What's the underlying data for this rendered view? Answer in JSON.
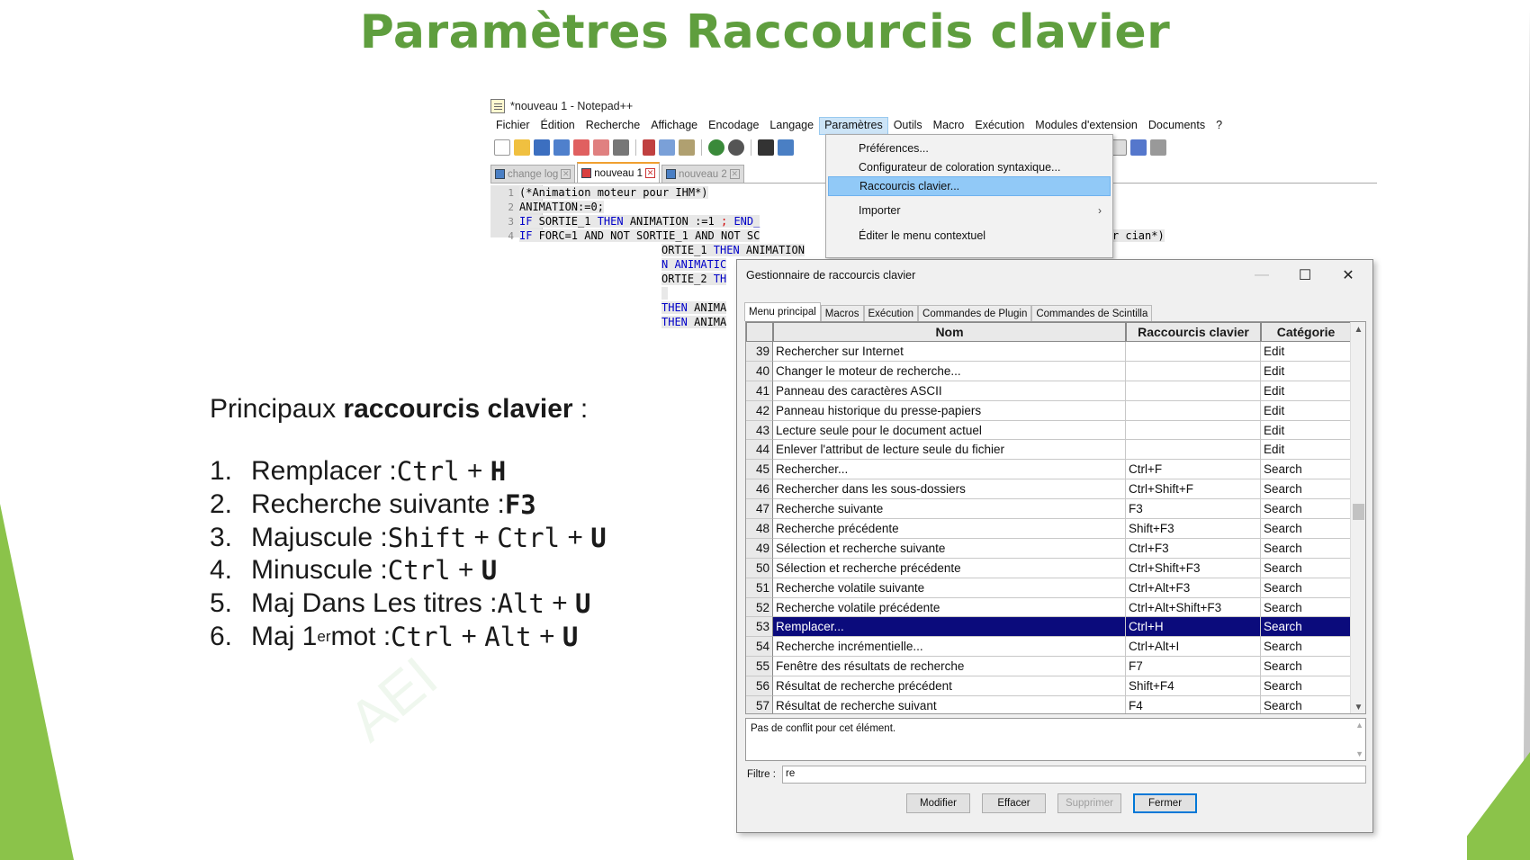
{
  "slide": {
    "title": "Paramètres Raccourcis clavier",
    "lead_text": "Principaux ",
    "lead_bold": "raccourcis clavier",
    "lead_end": " :",
    "watermark": "AEI",
    "shortcuts": [
      {
        "num": "1.",
        "label": "Remplacer : ",
        "parts": [
          {
            "t": "Ctrl",
            "s": "mono"
          },
          {
            "t": " + ",
            "s": "plain"
          },
          {
            "t": "H",
            "s": "kb"
          }
        ]
      },
      {
        "num": "2.",
        "label": "Recherche suivante : ",
        "parts": [
          {
            "t": "F3",
            "s": "kb"
          }
        ]
      },
      {
        "num": "3.",
        "label": "Majuscule : ",
        "parts": [
          {
            "t": "Shift",
            "s": "mono"
          },
          {
            "t": " + ",
            "s": "plain"
          },
          {
            "t": "Ctrl",
            "s": "mono"
          },
          {
            "t": " + ",
            "s": "plain"
          },
          {
            "t": "U",
            "s": "kb"
          }
        ]
      },
      {
        "num": "4.",
        "label": "Minuscule : ",
        "parts": [
          {
            "t": "Ctrl",
            "s": "mono"
          },
          {
            "t": " + ",
            "s": "plain"
          },
          {
            "t": "U",
            "s": "kb"
          }
        ]
      },
      {
        "num": "5.",
        "label": "Maj Dans Les titres : ",
        "parts": [
          {
            "t": "Alt",
            "s": "mono"
          },
          {
            "t": " + ",
            "s": "plain"
          },
          {
            "t": "U",
            "s": "kb"
          }
        ]
      },
      {
        "num": "6.",
        "label": "Maj 1",
        "sup": "er",
        "label2": " mot : ",
        "parts": [
          {
            "t": "Ctrl",
            "s": "mono"
          },
          {
            "t": " + ",
            "s": "plain"
          },
          {
            "t": "Alt",
            "s": "mono"
          },
          {
            "t": " + ",
            "s": "plain"
          },
          {
            "t": "U",
            "s": "kb"
          }
        ]
      }
    ]
  },
  "npp": {
    "window_title": "*nouveau 1 - Notepad++",
    "menu": [
      "Fichier",
      "Édition",
      "Recherche",
      "Affichage",
      "Encodage",
      "Langage",
      "Paramètres",
      "Outils",
      "Macro",
      "Exécution",
      "Modules d'extension",
      "Documents",
      "?"
    ],
    "active_menu": "Paramètres",
    "tabs": [
      "change log",
      "nouveau 1",
      "nouveau 2"
    ],
    "active_tab": "nouveau 1",
    "code": {
      "l1": "1",
      "l2": "2",
      "l3": "3",
      "l4": "4",
      "c1": "(*Animation moteur pour IHM*)",
      "c2": "ANIMATION:=0;",
      "c3_if": "IF",
      "c3_a": " SORTIE_1 ",
      "c3_then": "THEN",
      "c3_b": " ANIMATION :=1 ",
      "c3_semi": ";",
      "c3_end": " END_",
      "c4_if": "IF",
      "c4_a": " FORC=1 AND NOT SORTIE_1 AND NOT SC",
      "c4_tail": "uleur cian*)",
      "c5_a": "ORTIE_1 ",
      "c5_then": "THEN",
      "c5_b": " ANIMATION",
      "c6_a": "N ANIMATIC",
      "c7_a": "ORTIE_2 ",
      "c7_then": "TH",
      "c8_then": "THEN",
      "c8_b": " ANIMA",
      "c9_then": "THEN",
      "c9_b": " ANIMA"
    },
    "dropdown": {
      "items": [
        "Préférences...",
        "Configurateur de coloration syntaxique...",
        "Raccourcis clavier...",
        "Importer",
        "Éditer le menu contextuel"
      ],
      "highlighted": "Raccourcis clavier...",
      "submenu_arrow": "›"
    }
  },
  "dialog": {
    "title": "Gestionnaire de raccourcis clavier",
    "controls": {
      "minimize": "—",
      "maximize": "☐",
      "close": "✕"
    },
    "tabs": [
      "Menu principal",
      "Macros",
      "Exécution",
      "Commandes de Plugin",
      "Commandes de Scintilla"
    ],
    "active_tab": "Menu principal",
    "columns": {
      "name": "Nom",
      "shortcut": "Raccourcis clavier",
      "category": "Catégorie"
    },
    "rows": [
      {
        "n": "39",
        "name": "Rechercher sur Internet",
        "shortcut": "",
        "category": "Edit"
      },
      {
        "n": "40",
        "name": "Changer le moteur de recherche...",
        "shortcut": "",
        "category": "Edit"
      },
      {
        "n": "41",
        "name": "Panneau des caractères ASCII",
        "shortcut": "",
        "category": "Edit"
      },
      {
        "n": "42",
        "name": "Panneau historique du presse-papiers",
        "shortcut": "",
        "category": "Edit"
      },
      {
        "n": "43",
        "name": "Lecture seule pour le document actuel",
        "shortcut": "",
        "category": "Edit"
      },
      {
        "n": "44",
        "name": "Enlever l'attribut de lecture seule du fichier",
        "shortcut": "",
        "category": "Edit"
      },
      {
        "n": "45",
        "name": "Rechercher...",
        "shortcut": "Ctrl+F",
        "category": "Search"
      },
      {
        "n": "46",
        "name": "Rechercher dans les sous-dossiers",
        "shortcut": "Ctrl+Shift+F",
        "category": "Search"
      },
      {
        "n": "47",
        "name": "Recherche suivante",
        "shortcut": "F3",
        "category": "Search"
      },
      {
        "n": "48",
        "name": "Recherche précédente",
        "shortcut": "Shift+F3",
        "category": "Search"
      },
      {
        "n": "49",
        "name": "Sélection et recherche suivante",
        "shortcut": "Ctrl+F3",
        "category": "Search"
      },
      {
        "n": "50",
        "name": "Sélection et recherche précédente",
        "shortcut": "Ctrl+Shift+F3",
        "category": "Search"
      },
      {
        "n": "51",
        "name": "Recherche volatile suivante",
        "shortcut": "Ctrl+Alt+F3",
        "category": "Search"
      },
      {
        "n": "52",
        "name": "Recherche volatile précédente",
        "shortcut": "Ctrl+Alt+Shift+F3",
        "category": "Search"
      },
      {
        "n": "53",
        "name": "Remplacer...",
        "shortcut": "Ctrl+H",
        "category": "Search",
        "selected": true
      },
      {
        "n": "54",
        "name": "Recherche incrémentielle...",
        "shortcut": "Ctrl+Alt+I",
        "category": "Search"
      },
      {
        "n": "55",
        "name": "Fenêtre des résultats de recherche",
        "shortcut": "F7",
        "category": "Search"
      },
      {
        "n": "56",
        "name": "Résultat de recherche précédent",
        "shortcut": "Shift+F4",
        "category": "Search"
      },
      {
        "n": "57",
        "name": "Résultat de recherche suivant",
        "shortcut": "F4",
        "category": "Search"
      }
    ],
    "conflict_text": "Pas de conflit pour cet élément.",
    "filter_label": "Filtre :",
    "filter_value": "re",
    "buttons": {
      "modify": "Modifier",
      "clear": "Effacer",
      "delete": "Supprimer",
      "close": "Fermer"
    }
  },
  "colors": {
    "title_green": "#5f9e3e",
    "accent_green": "#8bc34a",
    "selection": "#0b0b7c"
  }
}
